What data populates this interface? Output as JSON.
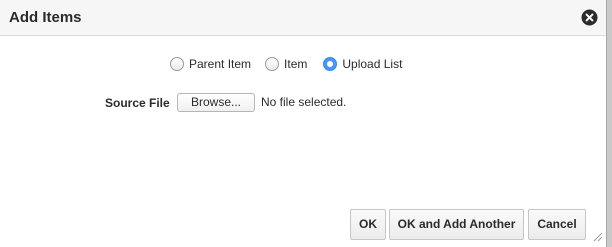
{
  "dialog": {
    "title": "Add Items",
    "close_icon": "close-circle-icon"
  },
  "item_type": {
    "options": [
      {
        "label": "Parent Item",
        "selected": false
      },
      {
        "label": "Item",
        "selected": false
      },
      {
        "label": "Upload List",
        "selected": true
      }
    ]
  },
  "source_file": {
    "label": "Source File",
    "browse_label": "Browse...",
    "status": "No file selected."
  },
  "footer": {
    "ok_label": "OK",
    "ok_add_another_label": "OK and Add Another",
    "cancel_label": "Cancel"
  },
  "colors": {
    "accent": "#4a97f3",
    "titlebar": "#f6f6f6",
    "button_bg": "#ececec"
  }
}
